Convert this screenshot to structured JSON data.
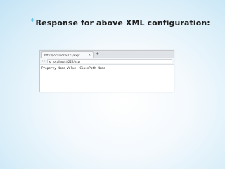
{
  "slide": {
    "bullet": "*",
    "title": "Response for above XML configuration:"
  },
  "browser": {
    "tab_title": "http://localhost8222/expr",
    "tab_close": "×",
    "new_tab": "+",
    "nav_back": "‹",
    "nav_forward": "›",
    "address": "localhost:8222/expr"
  },
  "page": {
    "response_text": "Property Name Value:-ClassPath Name"
  },
  "colors": {
    "bullet": "#29abe2",
    "background_edge": "#c3e3f5"
  }
}
